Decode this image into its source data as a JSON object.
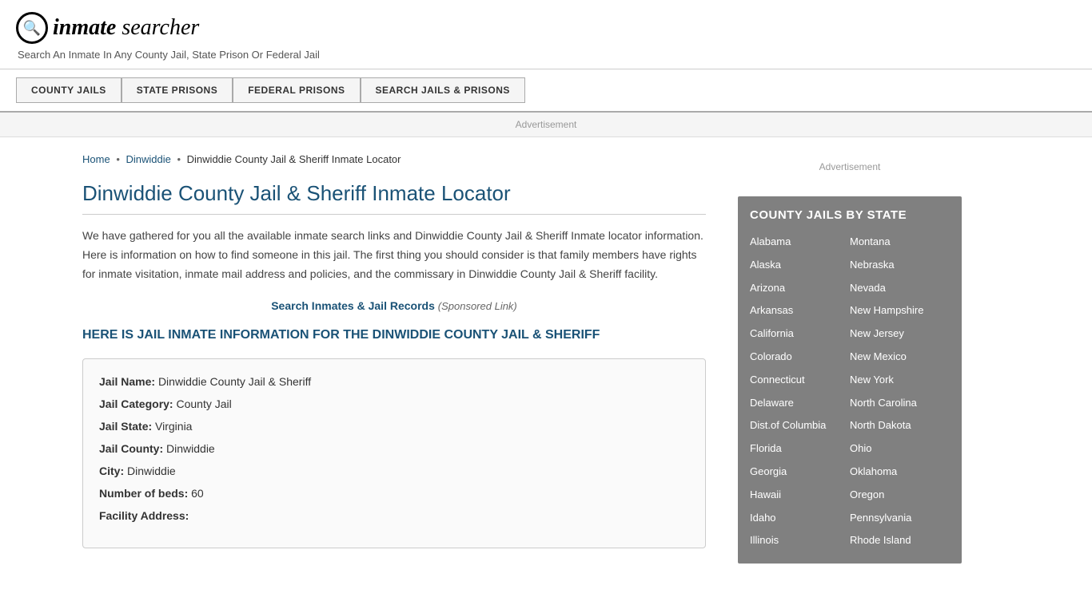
{
  "header": {
    "logo_icon": "🔍",
    "logo_name": "inmate searcher",
    "tagline": "Search An Inmate In Any County Jail, State Prison Or Federal Jail"
  },
  "nav": {
    "buttons": [
      {
        "id": "county-jails",
        "label": "COUNTY JAILS"
      },
      {
        "id": "state-prisons",
        "label": "STATE PRISONS"
      },
      {
        "id": "federal-prisons",
        "label": "FEDERAL PRISONS"
      },
      {
        "id": "search-jails",
        "label": "SEARCH JAILS & PRISONS"
      }
    ]
  },
  "ad_label": "Advertisement",
  "breadcrumb": {
    "home": "Home",
    "parent": "Dinwiddie",
    "current": "Dinwiddie County Jail & Sheriff Inmate Locator"
  },
  "page_title": "Dinwiddie County Jail & Sheriff Inmate Locator",
  "description": "We have gathered for you all the available inmate search links and Dinwiddie County Jail & Sheriff Inmate locator information. Here is information on how to find someone in this jail. The first thing you should consider is that family members have rights for inmate visitation, inmate mail address and policies, and the commissary in Dinwiddie County Jail & Sheriff facility.",
  "search_link": "Search Inmates & Jail Records",
  "sponsored_text": "(Sponsored Link)",
  "section_heading": "HERE IS JAIL INMATE INFORMATION FOR THE DINWIDDIE COUNTY JAIL & SHERIFF",
  "jail_info": {
    "name_label": "Jail Name:",
    "name_value": "Dinwiddie County Jail & Sheriff",
    "category_label": "Jail Category:",
    "category_value": "County Jail",
    "state_label": "Jail State:",
    "state_value": "Virginia",
    "county_label": "Jail County:",
    "county_value": "Dinwiddie",
    "city_label": "City:",
    "city_value": "Dinwiddie",
    "beds_label": "Number of beds:",
    "beds_value": "60",
    "address_label": "Facility Address:"
  },
  "sidebar": {
    "ad_label": "Advertisement",
    "county_jails_title": "COUNTY JAILS BY STATE",
    "states_col1": [
      "Alabama",
      "Alaska",
      "Arizona",
      "Arkansas",
      "California",
      "Colorado",
      "Connecticut",
      "Delaware",
      "Dist.of Columbia",
      "Florida",
      "Georgia",
      "Hawaii",
      "Idaho",
      "Illinois"
    ],
    "states_col2": [
      "Montana",
      "Nebraska",
      "Nevada",
      "New Hampshire",
      "New Jersey",
      "New Mexico",
      "New York",
      "North Carolina",
      "North Dakota",
      "Ohio",
      "Oklahoma",
      "Oregon",
      "Pennsylvania",
      "Rhode Island"
    ]
  }
}
